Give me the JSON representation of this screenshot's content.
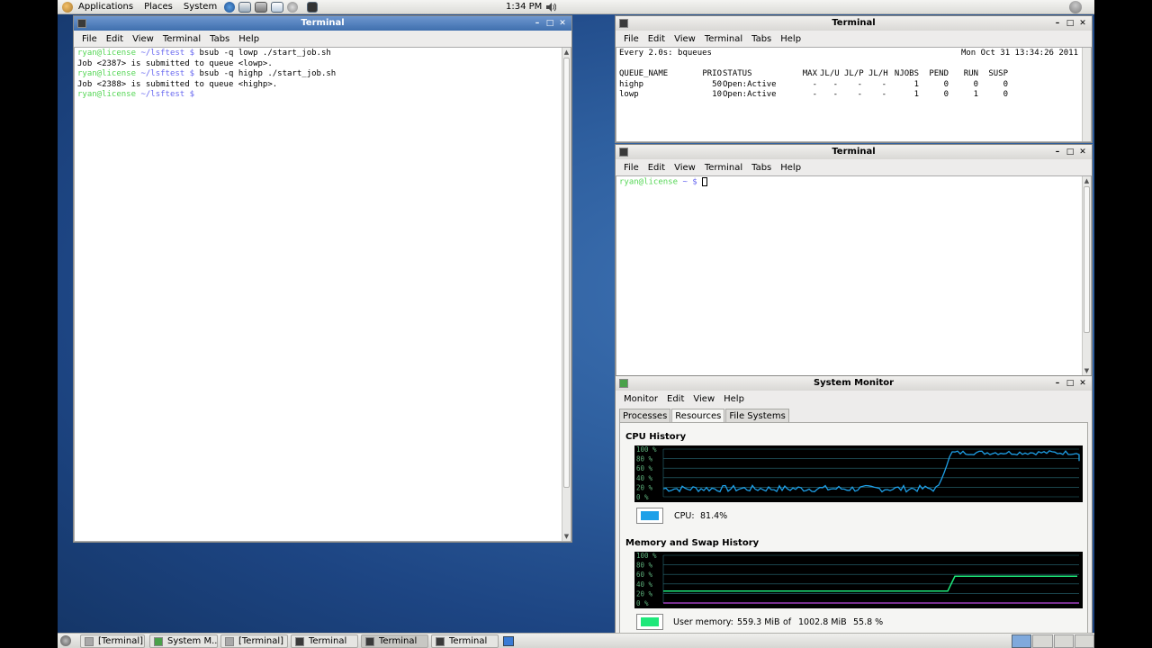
{
  "panel": {
    "menu": [
      "Applications",
      "Places",
      "System"
    ],
    "clock": "1:34 PM"
  },
  "terminal_main": {
    "title": "Terminal",
    "menu": [
      "File",
      "Edit",
      "View",
      "Terminal",
      "Tabs",
      "Help"
    ],
    "prompt_user": "ryan@license",
    "prompt_path": "~/lsftest $",
    "lines": [
      {
        "type": "cmd",
        "text": "bsub -q lowp ./start_job.sh"
      },
      {
        "type": "out",
        "text": "Job <2387> is submitted to queue <lowp>."
      },
      {
        "type": "cmd",
        "text": "bsub -q highp ./start_job.sh"
      },
      {
        "type": "out",
        "text": "Job <2388> is submitted to queue <highp>."
      },
      {
        "type": "cmd",
        "text": ""
      }
    ]
  },
  "terminal_watch": {
    "title": "Terminal",
    "menu": [
      "File",
      "Edit",
      "View",
      "Terminal",
      "Tabs",
      "Help"
    ],
    "header_left": "Every 2.0s: bqueues",
    "header_right": "Mon Oct 31 13:34:26 2011",
    "columns": [
      "QUEUE_NAME",
      "PRIO",
      "STATUS",
      "MAX",
      "JL/U",
      "JL/P",
      "JL/H",
      "NJOBS",
      "PEND",
      "RUN",
      "SUSP"
    ],
    "rows": [
      [
        "highp",
        "50",
        "Open:Active",
        "-",
        "-",
        "-",
        "-",
        "1",
        "0",
        "0",
        "0"
      ],
      [
        "lowp",
        "10",
        "Open:Active",
        "-",
        "-",
        "-",
        "-",
        "1",
        "0",
        "1",
        "0"
      ]
    ]
  },
  "terminal_shell": {
    "title": "Terminal",
    "menu": [
      "File",
      "Edit",
      "View",
      "Terminal",
      "Tabs",
      "Help"
    ],
    "prompt_user": "ryan@license",
    "prompt_path": "~ $"
  },
  "system_monitor": {
    "title": "System Monitor",
    "menu": [
      "Monitor",
      "Edit",
      "View",
      "Help"
    ],
    "tabs": [
      "Processes",
      "Resources",
      "File Systems"
    ],
    "selected_tab": "Resources",
    "cpu_title": "CPU History",
    "cpu_ticks": [
      "100 %",
      "80 %",
      "60 %",
      "40 %",
      "20 %",
      "0 %"
    ],
    "cpu_label": "CPU:",
    "cpu_value": "81.4%",
    "cpu_color": "#1ea0e8",
    "mem_title": "Memory and Swap History",
    "mem_ticks": [
      "100 %",
      "80 %",
      "60 %",
      "40 %",
      "20 %",
      "0 %"
    ],
    "mem_label": "User memory:",
    "mem_used": "559.3 MiB",
    "mem_of": "of",
    "mem_total": "1002.8 MiB",
    "mem_pct": "55.8 %",
    "mem_color": "#1ee87a",
    "swap_color": "#a040c0"
  },
  "taskbar": {
    "items": [
      {
        "label": "[Terminal]",
        "icon": "terminal-icon"
      },
      {
        "label": "System M...",
        "icon": "system-monitor-icon"
      },
      {
        "label": "[Terminal]",
        "icon": "terminal-icon"
      },
      {
        "label": "Terminal",
        "icon": "terminal-icon"
      },
      {
        "label": "Terminal",
        "icon": "terminal-icon",
        "current": true
      },
      {
        "label": "Terminal",
        "icon": "terminal-icon"
      }
    ]
  }
}
